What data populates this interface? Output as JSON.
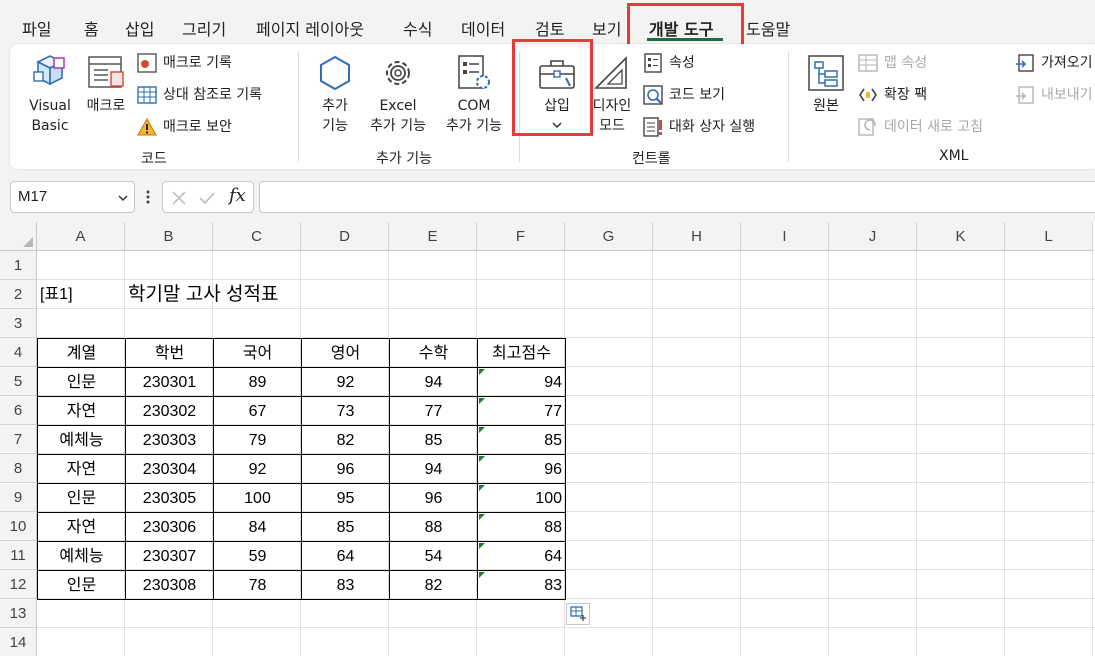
{
  "menu": {
    "items": [
      "파일",
      "홈",
      "삽입",
      "그리기",
      "페이지 레이아웃",
      "수식",
      "데이터",
      "검토",
      "보기",
      "개발 도구",
      "도움말"
    ],
    "active": "개발 도구"
  },
  "ribbon": {
    "code": {
      "visual_basic": [
        "Visual",
        "Basic"
      ],
      "macro": "매크로",
      "record_macro": "매크로 기록",
      "relative_ref": "상대 참조로 기록",
      "macro_security": "매크로 보안",
      "group_label": "코드"
    },
    "addins": {
      "addins": [
        "추가",
        "기능"
      ],
      "excel_addins": [
        "Excel",
        "추가 기능"
      ],
      "com_addins": [
        "COM",
        "추가 기능"
      ],
      "group_label": "추가 기능"
    },
    "controls": {
      "insert": "삽입",
      "design_mode": [
        "디자인",
        "모드"
      ],
      "properties": "속성",
      "view_code": "코드 보기",
      "run_dialog": "대화 상자 실행",
      "group_label": "컨트롤"
    },
    "xml": {
      "source": "원본",
      "map_properties": "맵 속성",
      "expansion_packs": "확장 팩",
      "refresh_data": "데이터 새로 고침",
      "import": "가져오기",
      "export": "내보내기",
      "group_label": "XML"
    }
  },
  "formula_bar": {
    "name_box": "M17",
    "fx_label": "fx",
    "formula": ""
  },
  "sheet": {
    "columns": [
      "A",
      "B",
      "C",
      "D",
      "E",
      "F",
      "G",
      "H",
      "I",
      "J",
      "K",
      "L"
    ],
    "rows": [
      "1",
      "2",
      "3",
      "4",
      "5",
      "6",
      "7",
      "8",
      "9",
      "10",
      "11",
      "12",
      "13",
      "14"
    ],
    "table_label": "[표1]",
    "title": "학기말 고사 성적표",
    "headers": [
      "계열",
      "학번",
      "국어",
      "영어",
      "수학",
      "최고점수"
    ],
    "data": [
      [
        "인문",
        "230301",
        "89",
        "92",
        "94",
        "94"
      ],
      [
        "자연",
        "230302",
        "67",
        "73",
        "77",
        "77"
      ],
      [
        "예체능",
        "230303",
        "79",
        "82",
        "85",
        "85"
      ],
      [
        "자연",
        "230304",
        "92",
        "96",
        "94",
        "96"
      ],
      [
        "인문",
        "230305",
        "100",
        "95",
        "96",
        "100"
      ],
      [
        "자연",
        "230306",
        "84",
        "85",
        "88",
        "88"
      ],
      [
        "예체능",
        "230307",
        "59",
        "64",
        "54",
        "64"
      ],
      [
        "인문",
        "230308",
        "78",
        "83",
        "82",
        "83"
      ]
    ]
  },
  "colors": {
    "highlight": "#e83a3a",
    "accent": "#1f6e43",
    "error_triangle": "#1e7d32"
  }
}
